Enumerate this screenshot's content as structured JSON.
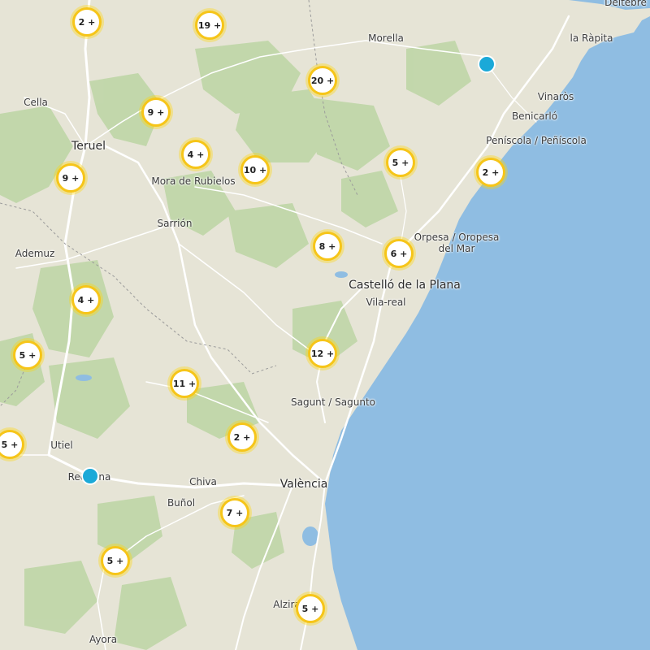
{
  "colors": {
    "land": "#e6e4d6",
    "sea": "#8fbde2",
    "forest": "#b9d3a1",
    "road": "#ffffff",
    "cluster_ring": "#f6c519",
    "pin": "#1ba9d8"
  },
  "places": [
    {
      "id": "deltebre",
      "label": "Deltebre"
    },
    {
      "id": "morella",
      "label": "Morella"
    },
    {
      "id": "la-rapita",
      "label": "la Ràpita"
    },
    {
      "id": "cella",
      "label": "Cella"
    },
    {
      "id": "vinaros",
      "label": "Vinaròs"
    },
    {
      "id": "benicarlo",
      "label": "Benicarló"
    },
    {
      "id": "teruel",
      "label": "Teruel"
    },
    {
      "id": "peniscola",
      "label": "Peníscola / Peñíscola"
    },
    {
      "id": "mora",
      "label": "Mora de Rubielos"
    },
    {
      "id": "sarrion",
      "label": "Sarrión"
    },
    {
      "id": "orpesa",
      "label": "Orpesa / Oropesa del Mar"
    },
    {
      "id": "ademuz",
      "label": "Ademuz"
    },
    {
      "id": "castello",
      "label": "Castelló de la Plana"
    },
    {
      "id": "vila-real",
      "label": "Vila-real"
    },
    {
      "id": "sagunt",
      "label": "Sagunt / Sagunto"
    },
    {
      "id": "utiel",
      "label": "Utiel"
    },
    {
      "id": "requena",
      "label": "Requena"
    },
    {
      "id": "chiva",
      "label": "Chiva"
    },
    {
      "id": "valencia",
      "label": "València"
    },
    {
      "id": "bunol",
      "label": "Buñol"
    },
    {
      "id": "alzira",
      "label": "Alzira"
    },
    {
      "id": "ayora",
      "label": "Ayora"
    }
  ],
  "clusters": [
    {
      "label": "2 +"
    },
    {
      "label": "19 +"
    },
    {
      "label": "20 +"
    },
    {
      "label": "9 +"
    },
    {
      "label": "4 +"
    },
    {
      "label": "10 +"
    },
    {
      "label": "5 +"
    },
    {
      "label": "2 +"
    },
    {
      "label": "9 +"
    },
    {
      "label": "8 +"
    },
    {
      "label": "6 +"
    },
    {
      "label": "4 +"
    },
    {
      "label": "5 +"
    },
    {
      "label": "12 +"
    },
    {
      "label": "11 +"
    },
    {
      "label": "5 +"
    },
    {
      "label": "2 +"
    },
    {
      "label": "7 +"
    },
    {
      "label": "5 +"
    },
    {
      "label": "5 +"
    }
  ],
  "pins": [
    {
      "name": "location-marker-north"
    },
    {
      "name": "location-marker-requena"
    }
  ]
}
